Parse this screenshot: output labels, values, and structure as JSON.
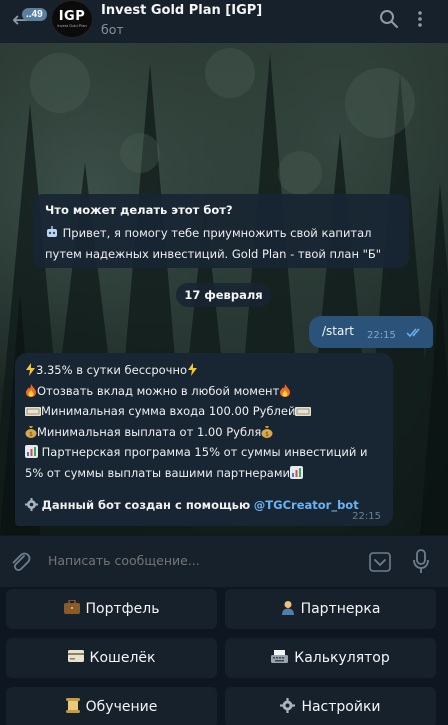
{
  "header": {
    "unread_count": "..49",
    "avatar_text": "IGP",
    "avatar_subtext": "Invest Gold Plan",
    "title": "Invest Gold Plan [IGP]",
    "subtitle": "бот"
  },
  "bot_info": {
    "title": "Что может делать этот бот?",
    "line1": "Привет, я помогу тебе приумножить свой капитал",
    "line2": "путем надежных инвестиций. Gold Plan - твой план \"Б\""
  },
  "date_separator": "17 февраля",
  "outgoing_message": {
    "text": "/start",
    "time": "22:15"
  },
  "incoming_message": {
    "line1": "3.35% в сутки бессрочно",
    "line2": "Отозвать вклад можно в любой момент",
    "line3": "Минимальная сумма входа 100.00 Рублей",
    "line4": "Минимальная выплата от 1.00 Рубля",
    "line5a": "Партнерская программа 15% от суммы инвестиций и",
    "line5b": "5% от суммы выплаты вашими партнерами",
    "footer_text": "Данный бот создан с помощью",
    "footer_link": "@TGCreator_bot",
    "time": "22:15"
  },
  "composer": {
    "placeholder": "Написать сообщение..."
  },
  "keyboard": {
    "portfolio": "Портфель",
    "partners": "Партнерка",
    "wallet": "Кошелёк",
    "calculator": "Калькулятор",
    "learning": "Обучение",
    "settings": "Настройки"
  },
  "colors": {
    "header_bg": "#17212b",
    "bubble_in": "#182533",
    "bubble_out": "#2b5278",
    "link": "#6ab3f3",
    "accent": "#5b7f9f"
  }
}
